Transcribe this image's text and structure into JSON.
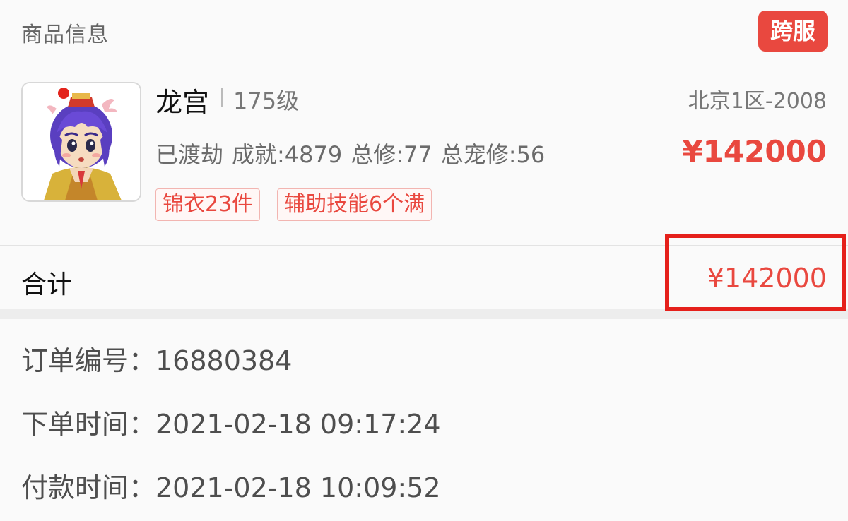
{
  "section_title": "商品信息",
  "cross_server_badge": "跨服",
  "product": {
    "name": "龙宫",
    "level": "175级",
    "server": "北京1区-2008",
    "stats": {
      "status": "已渡劫",
      "achievement": "成就:4879",
      "total_cultivation": "总修:77",
      "pet_cultivation": "总宠修:56"
    },
    "price": "¥142000",
    "tags": [
      "锦衣23件",
      "辅助技能6个满"
    ]
  },
  "total": {
    "label": "合计",
    "value": "¥142000"
  },
  "order": {
    "number": "订单编号：16880384",
    "created": "下单时间：2021-02-18 09:17:24",
    "paid": "付款时间：2021-02-18 10:09:52"
  },
  "colors": {
    "accent": "#e9483f",
    "highlight_border": "#e5201b"
  }
}
